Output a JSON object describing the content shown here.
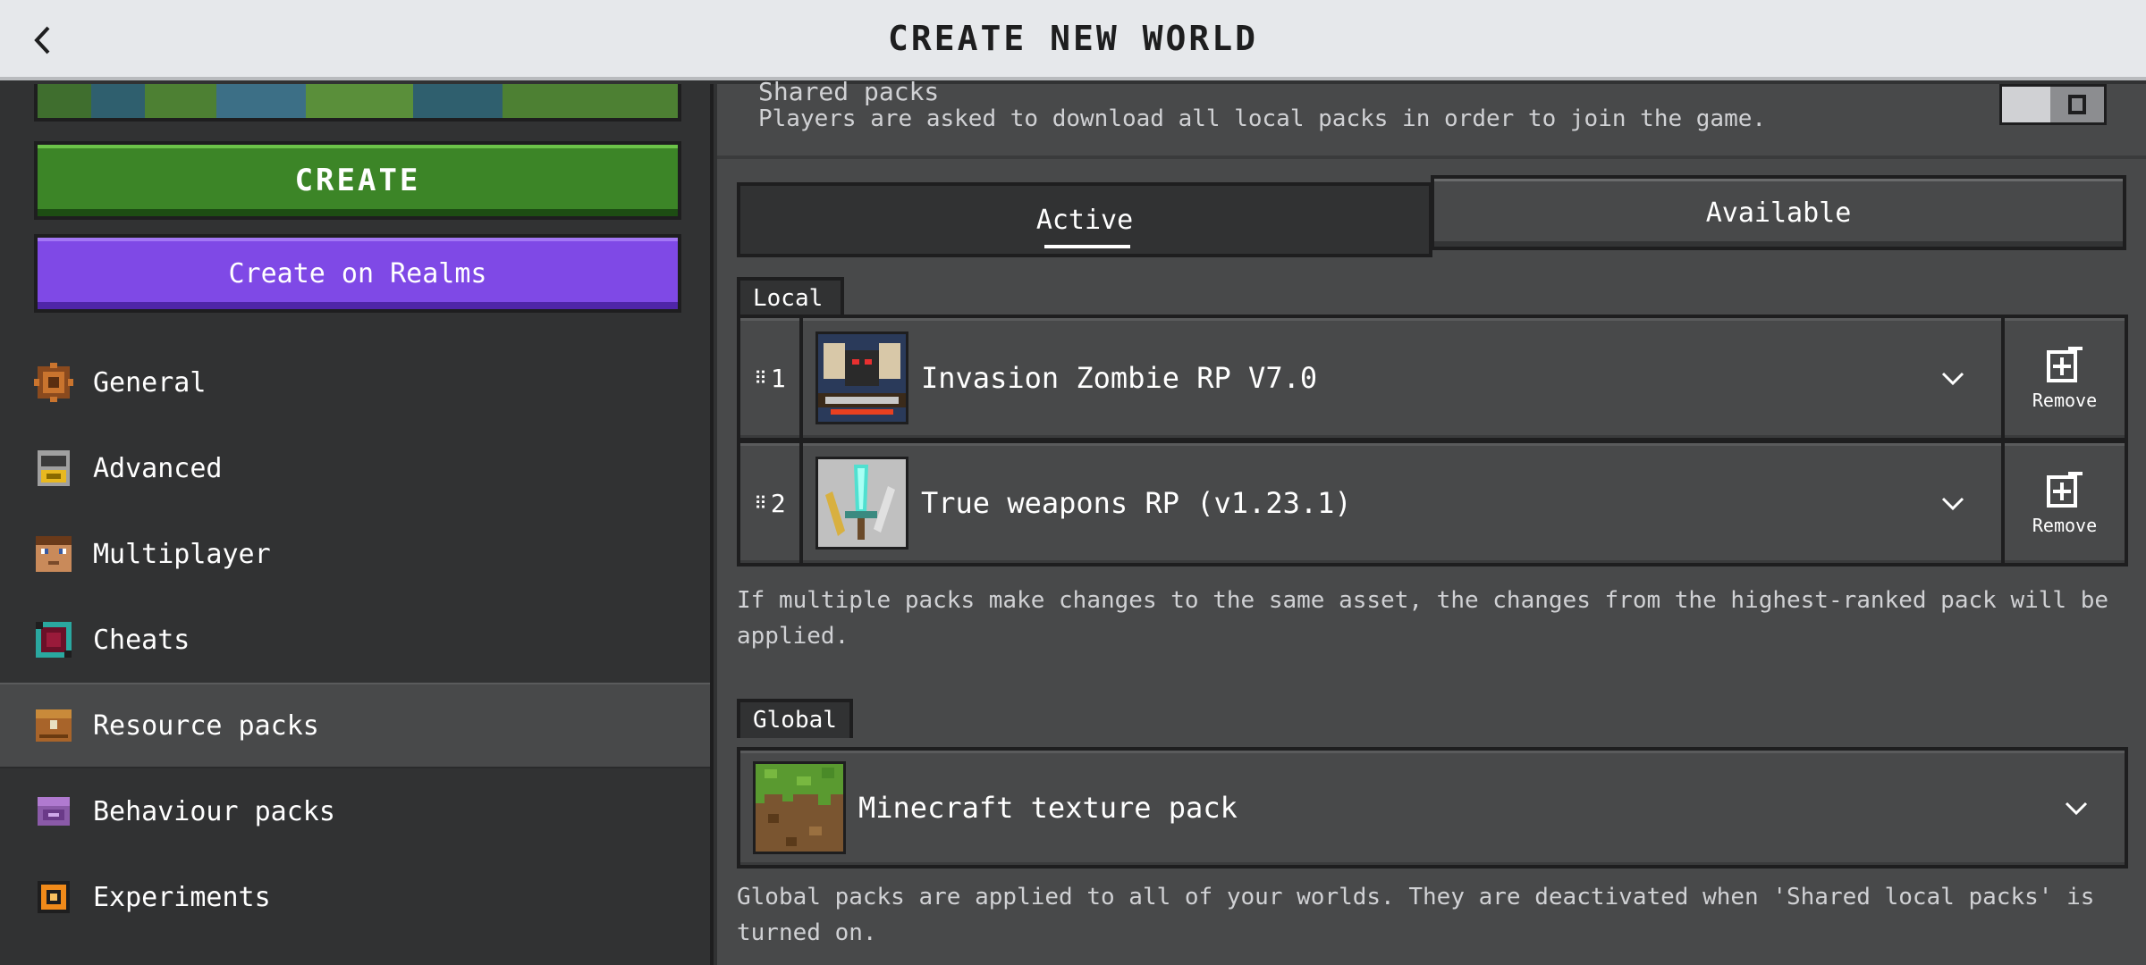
{
  "header": {
    "title": "CREATE NEW WORLD"
  },
  "left": {
    "create_label": "CREATE",
    "realms_label": "Create on Realms",
    "nav": [
      {
        "label": "General",
        "icon": "gear-icon"
      },
      {
        "label": "Advanced",
        "icon": "advanced-icon"
      },
      {
        "label": "Multiplayer",
        "icon": "multiplayer-icon"
      },
      {
        "label": "Cheats",
        "icon": "cheats-icon"
      },
      {
        "label": "Resource packs",
        "icon": "resource-packs-icon"
      },
      {
        "label": "Behaviour packs",
        "icon": "behaviour-packs-icon"
      },
      {
        "label": "Experiments",
        "icon": "experiments-icon"
      }
    ],
    "active_index": 4
  },
  "right": {
    "shared_label": "Shared packs",
    "shared_desc": "Players are asked to download all local packs in order to join the game.",
    "shared_toggle_on": false,
    "tabs": {
      "active": "Active",
      "available": "Available"
    },
    "local_tag": "Local",
    "local_packs": [
      {
        "rank": "1",
        "name": "Invasion Zombie RP V7.0",
        "remove_label": "Remove"
      },
      {
        "rank": "2",
        "name": "True weapons RP (v1.23.1)",
        "remove_label": "Remove"
      }
    ],
    "local_note": "If multiple packs make changes to the same asset, the changes from the highest-ranked pack will be applied.",
    "global_tag": "Global",
    "global_packs": [
      {
        "name": "Minecraft texture pack"
      }
    ],
    "global_note": "Global packs are applied to all of your worlds. They are deactivated when 'Shared local packs' is turned on."
  },
  "colors": {
    "create_green": "#3c8527",
    "realms_purple": "#7f49e6",
    "panel_dark": "#313233",
    "panel_mid": "#48494a",
    "header_bg": "#e6e8eb"
  }
}
